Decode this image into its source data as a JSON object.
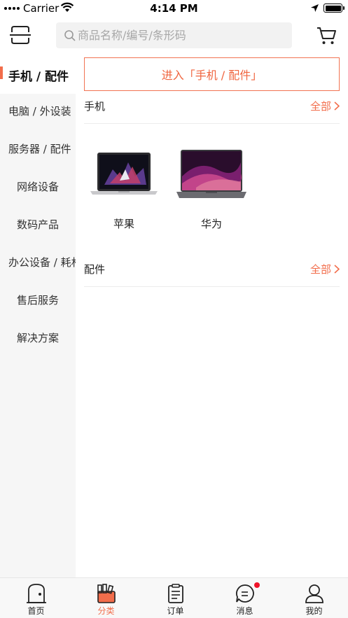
{
  "status_bar": {
    "carrier": "Carrier",
    "time": "4:14 PM"
  },
  "search": {
    "placeholder": "商品名称/编号/条形码"
  },
  "sidebar": {
    "items": [
      {
        "label": "手机 / 配件",
        "active": true
      },
      {
        "label": "电脑 / 外设装"
      },
      {
        "label": "服务器 / 配件"
      },
      {
        "label": "网络设备"
      },
      {
        "label": "数码产品"
      },
      {
        "label": "办公设备 / 耗材"
      },
      {
        "label": "售后服务"
      },
      {
        "label": "解决方案"
      }
    ]
  },
  "main": {
    "enter_label": "进入「手机 / 配件」",
    "sections": [
      {
        "title": "手机",
        "all_label": "全部",
        "brands": [
          {
            "label": "苹果",
            "icon": "macbook-image"
          },
          {
            "label": "华为",
            "icon": "matebook-image"
          }
        ]
      },
      {
        "title": "配件",
        "all_label": "全部"
      }
    ]
  },
  "tabs": [
    {
      "label": "首页",
      "icon": "home-icon"
    },
    {
      "label": "分类",
      "icon": "category-icon",
      "active": true
    },
    {
      "label": "订单",
      "icon": "order-icon"
    },
    {
      "label": "消息",
      "icon": "message-icon",
      "badge": true
    },
    {
      "label": "我的",
      "icon": "profile-icon"
    }
  ],
  "colors": {
    "accent": "#f26d4b",
    "badge": "#f0142a",
    "sidebar_bg": "#f6f6f6"
  }
}
